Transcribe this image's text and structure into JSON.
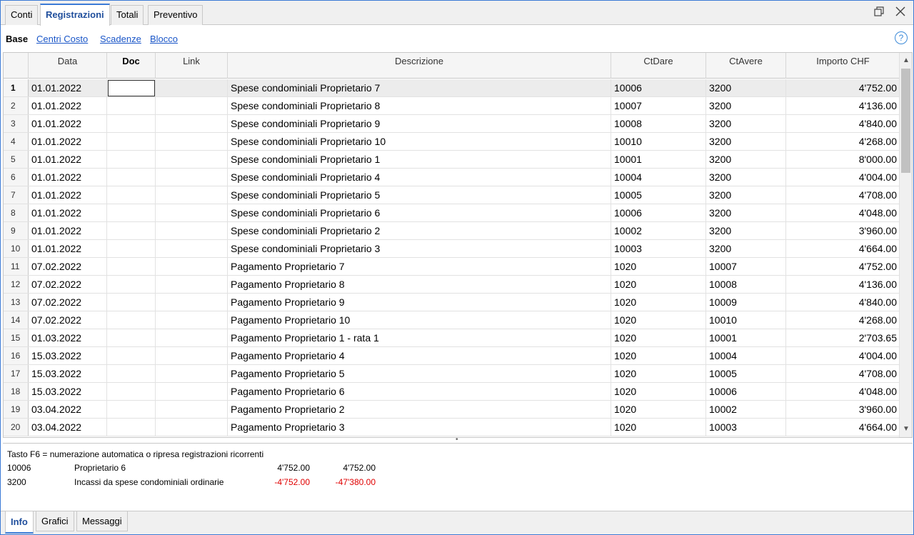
{
  "top_tabs": [
    "Conti",
    "Registrazioni",
    "Totali",
    "Preventivo"
  ],
  "sub_tabs": [
    "Base",
    "Centri Costo",
    "Scadenze",
    "Blocco"
  ],
  "help": "?",
  "columns": [
    "Data",
    "Doc",
    "Link",
    "Descrizione",
    "CtDare",
    "CtAvere",
    "Importo CHF"
  ],
  "rows": [
    {
      "n": "1",
      "data": "01.01.2022",
      "doc": "",
      "link": "",
      "desc": "Spese condominiali Proprietario 7",
      "dare": "10006",
      "avere": "3200",
      "importo": "4'752.00"
    },
    {
      "n": "2",
      "data": "01.01.2022",
      "doc": "",
      "link": "",
      "desc": "Spese condominiali Proprietario 8",
      "dare": "10007",
      "avere": "3200",
      "importo": "4'136.00"
    },
    {
      "n": "3",
      "data": "01.01.2022",
      "doc": "",
      "link": "",
      "desc": "Spese condominiali Proprietario 9",
      "dare": "10008",
      "avere": "3200",
      "importo": "4'840.00"
    },
    {
      "n": "4",
      "data": "01.01.2022",
      "doc": "",
      "link": "",
      "desc": "Spese condominiali Proprietario 10",
      "dare": "10010",
      "avere": "3200",
      "importo": "4'268.00"
    },
    {
      "n": "5",
      "data": "01.01.2022",
      "doc": "",
      "link": "",
      "desc": "Spese condominiali Proprietario 1",
      "dare": "10001",
      "avere": "3200",
      "importo": "8'000.00"
    },
    {
      "n": "6",
      "data": "01.01.2022",
      "doc": "",
      "link": "",
      "desc": "Spese condominiali Proprietario 4",
      "dare": "10004",
      "avere": "3200",
      "importo": "4'004.00"
    },
    {
      "n": "7",
      "data": "01.01.2022",
      "doc": "",
      "link": "",
      "desc": "Spese condominiali Proprietario 5",
      "dare": "10005",
      "avere": "3200",
      "importo": "4'708.00"
    },
    {
      "n": "8",
      "data": "01.01.2022",
      "doc": "",
      "link": "",
      "desc": "Spese condominiali Proprietario 6",
      "dare": "10006",
      "avere": "3200",
      "importo": "4'048.00"
    },
    {
      "n": "9",
      "data": "01.01.2022",
      "doc": "",
      "link": "",
      "desc": "Spese condominiali Proprietario 2",
      "dare": "10002",
      "avere": "3200",
      "importo": "3'960.00"
    },
    {
      "n": "10",
      "data": "01.01.2022",
      "doc": "",
      "link": "",
      "desc": "Spese condominiali Proprietario 3",
      "dare": "10003",
      "avere": "3200",
      "importo": "4'664.00"
    },
    {
      "n": "11",
      "data": "07.02.2022",
      "doc": "",
      "link": "",
      "desc": "Pagamento Proprietario 7",
      "dare": "1020",
      "avere": "10007",
      "importo": "4'752.00"
    },
    {
      "n": "12",
      "data": "07.02.2022",
      "doc": "",
      "link": "",
      "desc": "Pagamento Proprietario 8",
      "dare": "1020",
      "avere": "10008",
      "importo": "4'136.00"
    },
    {
      "n": "13",
      "data": "07.02.2022",
      "doc": "",
      "link": "",
      "desc": "Pagamento Proprietario 9",
      "dare": "1020",
      "avere": "10009",
      "importo": "4'840.00"
    },
    {
      "n": "14",
      "data": "07.02.2022",
      "doc": "",
      "link": "",
      "desc": "Pagamento Proprietario 10",
      "dare": "1020",
      "avere": "10010",
      "importo": "4'268.00"
    },
    {
      "n": "15",
      "data": "01.03.2022",
      "doc": "",
      "link": "",
      "desc": "Pagamento Proprietario 1 - rata 1",
      "dare": "1020",
      "avere": "10001",
      "importo": "2'703.65"
    },
    {
      "n": "16",
      "data": "15.03.2022",
      "doc": "",
      "link": "",
      "desc": "Pagamento Proprietario 4",
      "dare": "1020",
      "avere": "10004",
      "importo": "4'004.00"
    },
    {
      "n": "17",
      "data": "15.03.2022",
      "doc": "",
      "link": "",
      "desc": "Pagamento Proprietario 5",
      "dare": "1020",
      "avere": "10005",
      "importo": "4'708.00"
    },
    {
      "n": "18",
      "data": "15.03.2022",
      "doc": "",
      "link": "",
      "desc": "Pagamento Proprietario 6",
      "dare": "1020",
      "avere": "10006",
      "importo": "4'048.00"
    },
    {
      "n": "19",
      "data": "03.04.2022",
      "doc": "",
      "link": "",
      "desc": "Pagamento Proprietario 2",
      "dare": "1020",
      "avere": "10002",
      "importo": "3'960.00"
    },
    {
      "n": "20",
      "data": "03.04.2022",
      "doc": "",
      "link": "",
      "desc": "Pagamento Proprietario 3",
      "dare": "1020",
      "avere": "10003",
      "importo": "4'664.00"
    }
  ],
  "info": {
    "hint": "Tasto F6 = numerazione automatica o ripresa registrazioni ricorrenti",
    "line1": {
      "account": "10006",
      "name": "Proprietario 6",
      "amount": "4'752.00",
      "balance": "4'752.00"
    },
    "line2": {
      "account": "3200",
      "name": "Incassi da spese condominiali ordinarie",
      "amount": "-4'752.00",
      "balance": "-47'380.00"
    }
  },
  "bottom_tabs": [
    "Info",
    "Grafici",
    "Messaggi"
  ],
  "colors": {
    "accent": "#3c7bd6",
    "link": "#1a56c8",
    "negative": "#e00000"
  }
}
